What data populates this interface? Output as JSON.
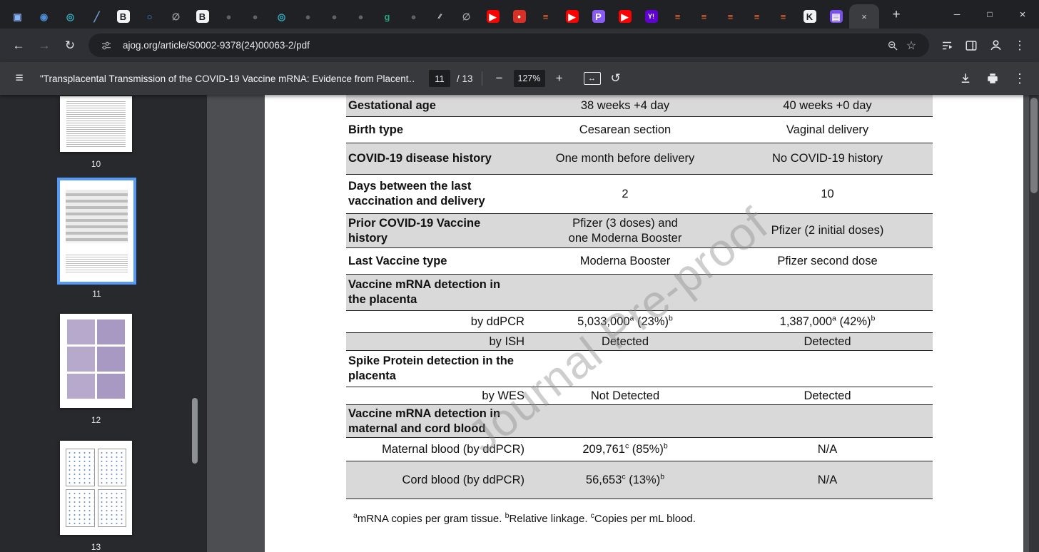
{
  "icons": {
    "back": "←",
    "forward": "→",
    "reload": "↻",
    "star": "☆",
    "kebab": "⋮",
    "minimize": "─",
    "maximize": "□",
    "close": "×",
    "new_tab": "+",
    "tab_close": "×",
    "hamburger": "≡",
    "zoom_out": "−",
    "zoom_in": "+",
    "rotate": "↺",
    "fit": "↔"
  },
  "browser": {
    "url": "ajog.org/article/S0002-9378(24)00063-2/pdf",
    "tabs": [
      {
        "icon": "grid-icon",
        "glyph": "▣",
        "fg": "#8ab4f8",
        "bg": "none"
      },
      {
        "icon": "compass-icon",
        "glyph": "◉",
        "fg": "#4d8fd6",
        "bg": "none"
      },
      {
        "icon": "map-pin-icon",
        "glyph": "◎",
        "fg": "#35b3c9",
        "bg": "none"
      },
      {
        "icon": "pen-icon",
        "glyph": "╱",
        "fg": "#6b9bd2",
        "bg": "none"
      },
      {
        "icon": "book-icon",
        "glyph": "B",
        "fg": "#202124",
        "bg": "#f1f3f4"
      },
      {
        "icon": "search-icon",
        "glyph": "○",
        "fg": "#4d8fd6",
        "bg": "none"
      },
      {
        "icon": "blocked-icon",
        "glyph": "∅",
        "fg": "#9aa0a6",
        "bg": "none"
      },
      {
        "icon": "book-icon",
        "glyph": "B",
        "fg": "#202124",
        "bg": "#f1f3f4"
      },
      {
        "icon": "generic-site-icon",
        "glyph": "●",
        "fg": "#5f6368",
        "bg": "none"
      },
      {
        "icon": "generic-site-icon",
        "glyph": "●",
        "fg": "#5f6368",
        "bg": "none"
      },
      {
        "icon": "map-pin-icon",
        "glyph": "◎",
        "fg": "#35b3c9",
        "bg": "none"
      },
      {
        "icon": "generic-site-icon",
        "glyph": "●",
        "fg": "#5f6368",
        "bg": "none"
      },
      {
        "icon": "generic-site-icon",
        "glyph": "●",
        "fg": "#5f6368",
        "bg": "none"
      },
      {
        "icon": "generic-site-icon",
        "glyph": "●",
        "fg": "#5f6368",
        "bg": "none"
      },
      {
        "icon": "greenhouse-icon",
        "glyph": "g",
        "fg": "#24a47f",
        "bg": "none"
      },
      {
        "icon": "generic-site-icon",
        "glyph": "●",
        "fg": "#5f6368",
        "bg": "none"
      },
      {
        "icon": "slashes-icon",
        "glyph": "⁄⁄",
        "fg": "#e8eaed",
        "bg": "none"
      },
      {
        "icon": "blocked-icon",
        "glyph": "∅",
        "fg": "#9aa0a6",
        "bg": "none"
      },
      {
        "icon": "youtube-icon",
        "glyph": "▶",
        "fg": "#ffffff",
        "bg": "#ff0000"
      },
      {
        "icon": "avatar-icon",
        "glyph": "•",
        "fg": "#ffffff",
        "bg": "#d93025"
      },
      {
        "icon": "reader-icon",
        "glyph": "≡",
        "fg": "#ff6a33",
        "bg": "none"
      },
      {
        "icon": "youtube-icon",
        "glyph": "▶",
        "fg": "#ffffff",
        "bg": "#ff0000"
      },
      {
        "icon": "patreon-icon",
        "glyph": "P",
        "fg": "#ffffff",
        "bg": "#8a5cf5"
      },
      {
        "icon": "youtube-icon",
        "glyph": "▶",
        "fg": "#ffffff",
        "bg": "#ff0000"
      },
      {
        "icon": "yahoo-icon",
        "glyph": "Y!",
        "fg": "#ffffff",
        "bg": "#5f01d1"
      },
      {
        "icon": "reader-icon",
        "glyph": "≡",
        "fg": "#ff6a33",
        "bg": "none"
      },
      {
        "icon": "reader-icon",
        "glyph": "≡",
        "fg": "#ff6a33",
        "bg": "none"
      },
      {
        "icon": "reader-icon",
        "glyph": "≡",
        "fg": "#ff6a33",
        "bg": "none"
      },
      {
        "icon": "reader-icon",
        "glyph": "≡",
        "fg": "#ff6a33",
        "bg": "none"
      },
      {
        "icon": "reader-icon",
        "glyph": "≡",
        "fg": "#ff6a33",
        "bg": "none"
      },
      {
        "icon": "kiwix-icon",
        "glyph": "K",
        "fg": "#202124",
        "bg": "#f1f3f4"
      },
      {
        "icon": "document-icon",
        "glyph": "▤",
        "fg": "#ffffff",
        "bg": "#7a4ff0"
      }
    ]
  },
  "pdf_toolbar": {
    "title": "\"Transplacental Transmission of the COVID-19 Vaccine mRNA: Evidence from Placent…",
    "page_current": "11",
    "page_total": "/ 13",
    "zoom_level": "127%"
  },
  "sidebar": {
    "thumbnails": [
      {
        "page": "10",
        "kind": "text",
        "selected": false
      },
      {
        "page": "11",
        "kind": "table",
        "selected": true
      },
      {
        "page": "12",
        "kind": "figures",
        "selected": false
      },
      {
        "page": "13",
        "kind": "plots",
        "selected": false
      }
    ],
    "selected_border_color": "#559af6"
  },
  "document": {
    "watermark": "Journal Pre-proof",
    "shaded_row_color": "#d9d9d9",
    "table": {
      "rows": [
        {
          "label": "Gestational age",
          "shaded": true,
          "c1": "38 weeks +4 day",
          "c2": "40 weeks +0 day"
        },
        {
          "label": "Birth type",
          "c1": "Cesarean section",
          "c2": "Vaginal delivery"
        },
        {
          "label": "COVID-19 disease history",
          "shaded": true,
          "c1": "One month before delivery",
          "c2": "No COVID-19 history"
        },
        {
          "label": "Days between the last vaccination and delivery",
          "c1": "2",
          "c2": "10"
        },
        {
          "label": "Prior COVID-19 Vaccine history",
          "shaded": true,
          "c1": [
            {
              "text": "Pfizer (3 doses) and"
            },
            {
              "br": true
            },
            {
              "text": "one Moderna Booster"
            }
          ],
          "c2": "Pfizer (2 initial doses)"
        },
        {
          "label": "Last Vaccine type",
          "c1": "Moderna Booster",
          "c2": "Pfizer second dose"
        },
        {
          "label": "Vaccine mRNA detection in the placenta",
          "shaded": true,
          "c1": "",
          "c2": ""
        },
        {
          "label": "by ddPCR",
          "sub": true,
          "c1": [
            {
              "text": "5,033,000"
            },
            {
              "sup": "a"
            },
            {
              "text": " (23%)"
            },
            {
              "sup": "b"
            }
          ],
          "c2": [
            {
              "text": "1,387,000"
            },
            {
              "sup": "a"
            },
            {
              "text": " (42%)"
            },
            {
              "sup": "b"
            }
          ]
        },
        {
          "label": "by ISH",
          "sub": true,
          "shaded": true,
          "c1": "Detected",
          "c2": "Detected"
        },
        {
          "label": "Spike Protein detection in the placenta",
          "c1": "",
          "c2": ""
        },
        {
          "label": "by WES",
          "sub": true,
          "c1": "Not Detected",
          "c2": "Detected"
        },
        {
          "label": "Vaccine mRNA detection in maternal and cord blood",
          "shaded": true,
          "c1": "",
          "c2": ""
        },
        {
          "label": "Maternal blood (by ddPCR)",
          "sub": true,
          "c1": [
            {
              "text": "209,761"
            },
            {
              "sup": "c"
            },
            {
              "text": " (85%)"
            },
            {
              "sup": "b"
            }
          ],
          "c2": "N/A"
        },
        {
          "label": "Cord blood (by ddPCR)",
          "sub": true,
          "shaded": true,
          "c1": [
            {
              "text": "56,653"
            },
            {
              "sup": "c"
            },
            {
              "text": " (13%)"
            },
            {
              "sup": "b"
            }
          ],
          "c2": "N/A"
        }
      ]
    },
    "footnote": [
      {
        "sup": "a"
      },
      {
        "text": "mRNA copies per gram tissue. "
      },
      {
        "sup": "b"
      },
      {
        "text": "Relative linkage. "
      },
      {
        "sup": "c"
      },
      {
        "text": "Copies per mL blood."
      }
    ]
  }
}
